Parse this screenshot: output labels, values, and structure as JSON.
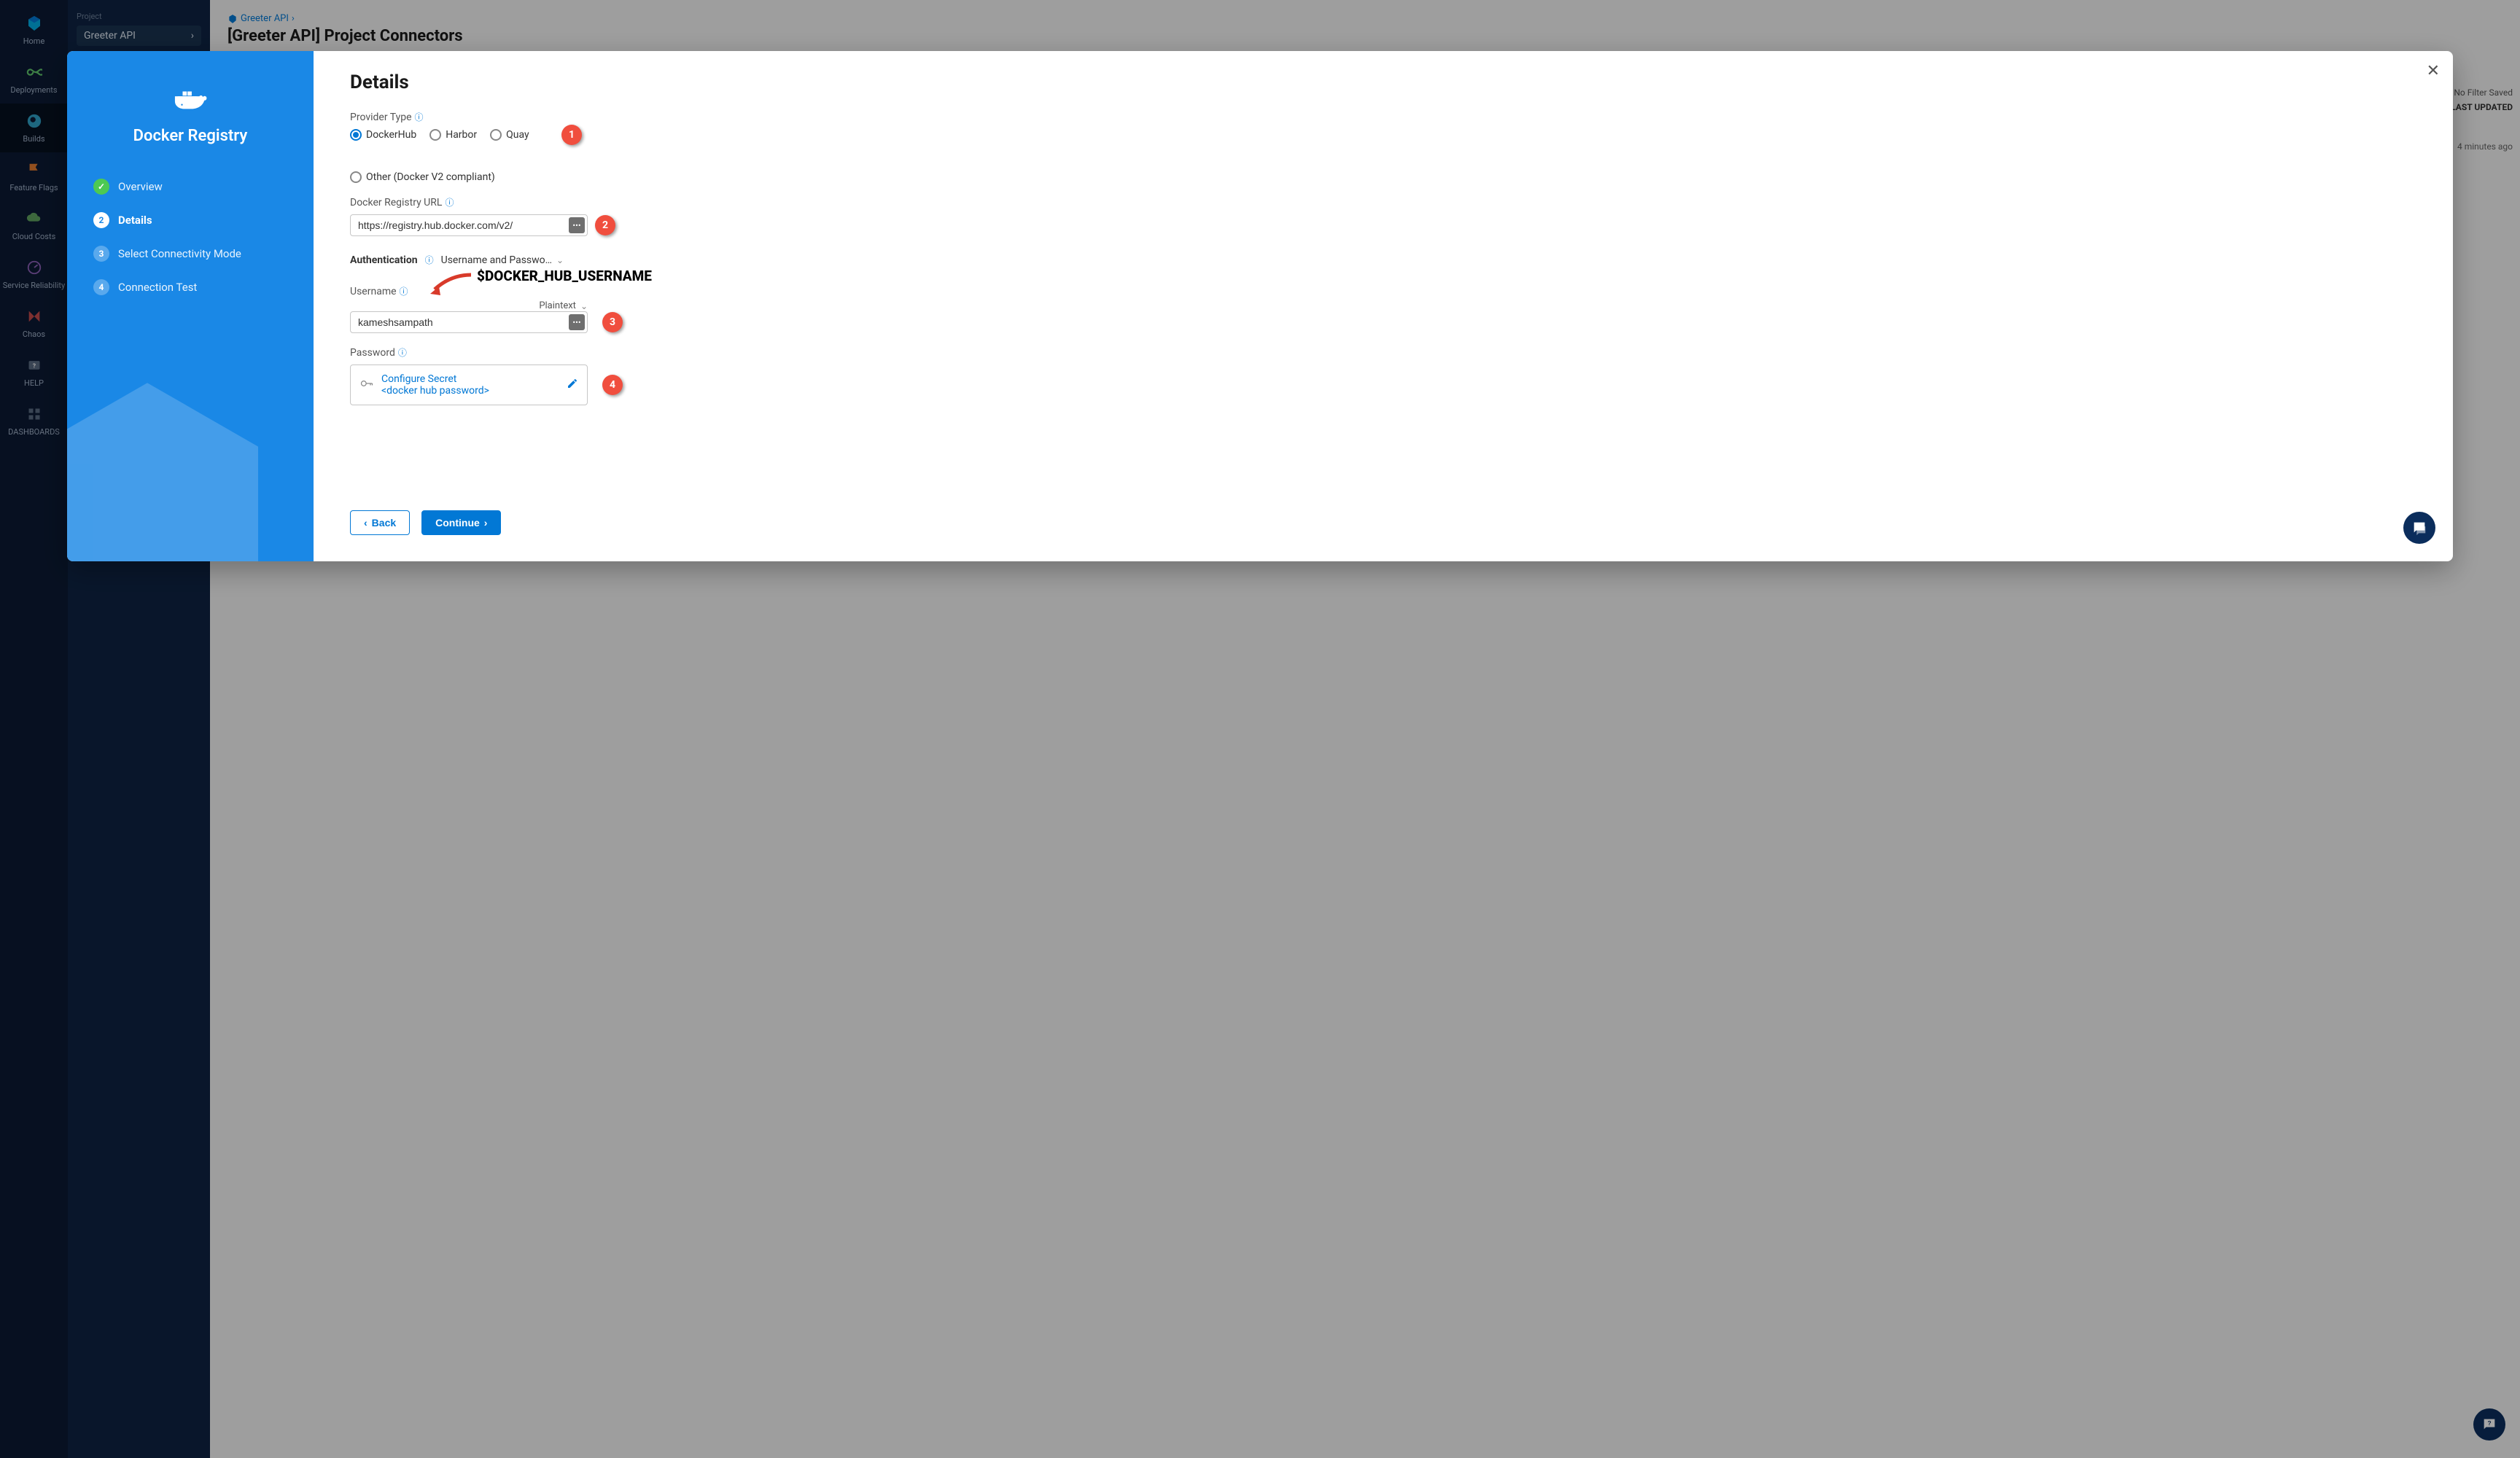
{
  "nav": {
    "items": [
      {
        "key": "home",
        "label": "Home"
      },
      {
        "key": "deployments",
        "label": "Deployments"
      },
      {
        "key": "builds",
        "label": "Builds"
      },
      {
        "key": "featureflags",
        "label": "Feature Flags"
      },
      {
        "key": "cloudcosts",
        "label": "Cloud Costs"
      },
      {
        "key": "servicereliability",
        "label": "Service Reliability"
      },
      {
        "key": "chaos",
        "label": "Chaos"
      },
      {
        "key": "help",
        "label": "HELP"
      },
      {
        "key": "dashboards",
        "label": "DASHBOARDS"
      }
    ]
  },
  "secondary": {
    "project_label": "Project",
    "project_value": "Greeter API"
  },
  "page": {
    "breadcrumb": "Greeter API",
    "title": "[Greeter API] Project Connectors",
    "filter_label": "No Filter Saved",
    "last_updated_header": "LAST UPDATED",
    "last_updated_value": "4 minutes ago"
  },
  "modal": {
    "left_title": "Docker Registry",
    "steps": {
      "overview": "Overview",
      "details": "Details",
      "connectivity": "Select Connectivity Mode",
      "connection_test": "Connection Test",
      "num2": "2",
      "num3": "3",
      "num4": "4"
    },
    "details_title": "Details",
    "provider_type_label": "Provider Type",
    "providers": {
      "dockerhub": "DockerHub",
      "harbor": "Harbor",
      "quay": "Quay",
      "other": "Other (Docker V2 compliant)"
    },
    "registry_url_label": "Docker Registry URL",
    "registry_url_value": "https://registry.hub.docker.com/v2/",
    "auth_label": "Authentication",
    "auth_value": "Username and Passwo…",
    "username_label": "Username",
    "username_value": "kameshsampath",
    "plaintext_label": "Plaintext",
    "password_label": "Password",
    "secret_line1": "Configure Secret",
    "secret_line2": "<docker hub password>",
    "back_btn": "Back",
    "continue_btn": "Continue"
  },
  "annotations": {
    "b1": "1",
    "b2": "2",
    "b3": "3",
    "b4": "4",
    "username_hint": "$DOCKER_HUB_USERNAME"
  }
}
